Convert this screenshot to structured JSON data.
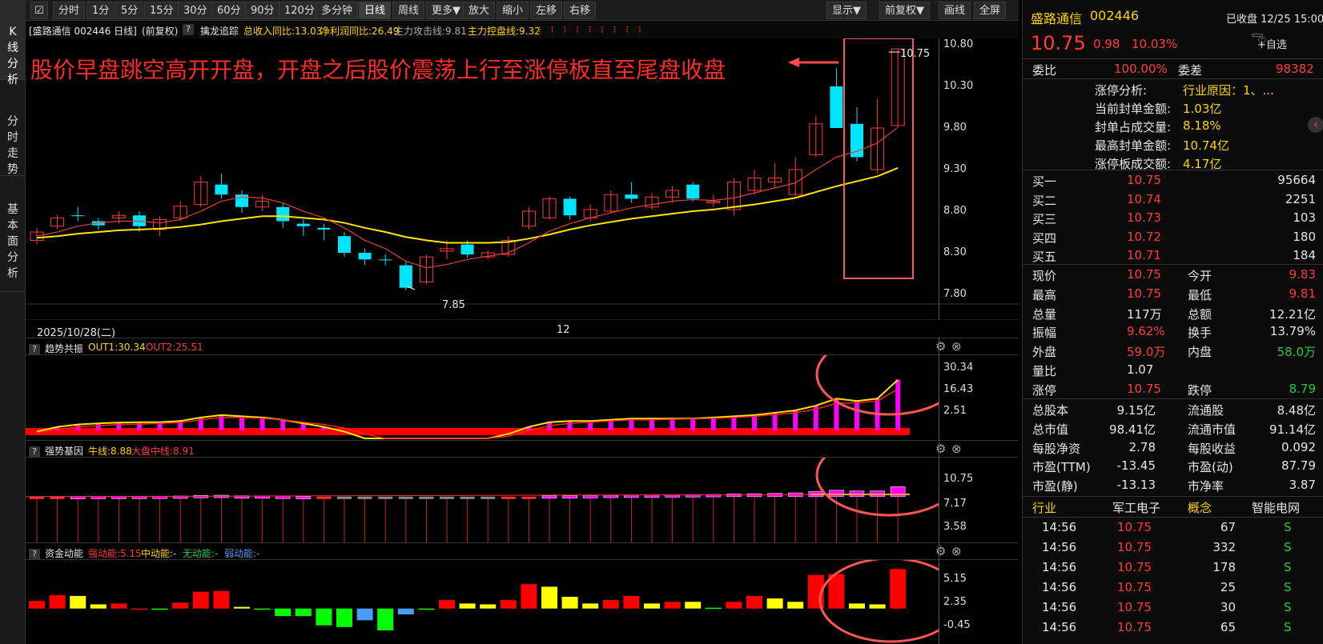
{
  "sidebar": {
    "tabs": [
      {
        "label": "K线分析"
      },
      {
        "label": "分时走势"
      },
      {
        "label": "基本面分析"
      }
    ]
  },
  "toolbar": {
    "left": [
      "分时",
      "1分",
      "5分",
      "15分",
      "30分",
      "60分",
      "90分",
      "120分",
      "多分钟",
      "日线",
      "周线",
      "更多▼",
      "放大",
      "缩小",
      "左移",
      "右移"
    ],
    "right": [
      "显示▼",
      "前复权▼",
      "画线",
      "全屏"
    ],
    "active": "日线"
  },
  "infobar": {
    "title": "[盛路通信 002446 日线]",
    "adj": "(前复权)",
    "qm": "?",
    "ind_name": "擒龙追踪",
    "rev": "总收入同比:13.03",
    "profit": "净利润同比:26.49",
    "attack": "主力攻击线:9.81",
    "control": "主力控盘线:9.32"
  },
  "annotation": {
    "text": "股价早盘跳空高开开盘，开盘之后股价震荡上行至涨停板直至尾盘收盘"
  },
  "main_chart": {
    "y_ticks": [
      "10.80",
      "10.30",
      "9.80",
      "9.30",
      "8.80",
      "8.30",
      "7.80"
    ],
    "date_left": "2025/10/28(二)",
    "date_mid": "12",
    "high_label": "10.75",
    "low_label": "7.85"
  },
  "panels": [
    {
      "name": "趋势共振",
      "v1": "OUT1:30.34",
      "v2": "OUT2:25.51",
      "ticks": [
        "30.34",
        "16.43",
        "2.51"
      ]
    },
    {
      "name": "强势基因",
      "v1": "牛线:8.88",
      "v2": "大盘中线:8.91",
      "ticks": [
        "10.75",
        "7.17",
        "3.58"
      ]
    },
    {
      "name": "资金动能",
      "v1": "强动能:5.15",
      "v2": "中动能:-",
      "v3": "无动能:-",
      "v4": "弱动能:-",
      "ticks": [
        "5.15",
        "2.35",
        "-0.45"
      ]
    }
  ],
  "chart_data": {
    "type": "candlestick",
    "ylim": [
      7.8,
      10.8
    ],
    "candles": [
      [
        8.45,
        8.55,
        8.4,
        8.6
      ],
      [
        8.62,
        8.72,
        8.58,
        8.76
      ],
      [
        8.75,
        8.74,
        8.68,
        8.85
      ],
      [
        8.68,
        8.63,
        8.58,
        8.72
      ],
      [
        8.72,
        8.75,
        8.65,
        8.8
      ],
      [
        8.75,
        8.62,
        8.55,
        8.8
      ],
      [
        8.58,
        8.7,
        8.5,
        8.74
      ],
      [
        8.72,
        8.86,
        8.68,
        8.92
      ],
      [
        8.88,
        9.15,
        8.85,
        9.22
      ],
      [
        9.12,
        9.0,
        8.95,
        9.25
      ],
      [
        9.0,
        8.85,
        8.78,
        9.05
      ],
      [
        8.85,
        8.92,
        8.8,
        9.0
      ],
      [
        8.85,
        8.68,
        8.6,
        8.9
      ],
      [
        8.65,
        8.62,
        8.5,
        8.7
      ],
      [
        8.6,
        8.58,
        8.45,
        8.65
      ],
      [
        8.5,
        8.3,
        8.25,
        8.55
      ],
      [
        8.3,
        8.22,
        8.15,
        8.35
      ],
      [
        8.22,
        8.21,
        8.15,
        8.28
      ],
      [
        8.15,
        7.88,
        7.85,
        8.2
      ],
      [
        7.95,
        8.25,
        7.92,
        8.28
      ],
      [
        8.32,
        8.35,
        8.22,
        8.45
      ],
      [
        8.4,
        8.28,
        8.24,
        8.45
      ],
      [
        8.25,
        8.3,
        8.22,
        8.33
      ],
      [
        8.28,
        8.45,
        8.25,
        8.5
      ],
      [
        8.62,
        8.8,
        8.58,
        8.85
      ],
      [
        8.72,
        8.95,
        8.7,
        8.98
      ],
      [
        8.95,
        8.75,
        8.7,
        8.98
      ],
      [
        8.72,
        8.82,
        8.68,
        8.88
      ],
      [
        8.8,
        9.0,
        8.78,
        9.05
      ],
      [
        9.0,
        8.95,
        8.9,
        9.15
      ],
      [
        8.85,
        8.97,
        8.82,
        9.02
      ],
      [
        8.97,
        9.05,
        8.9,
        9.1
      ],
      [
        9.12,
        8.95,
        8.92,
        9.15
      ],
      [
        8.9,
        8.92,
        8.85,
        9.0
      ],
      [
        8.82,
        9.15,
        8.75,
        9.2
      ],
      [
        9.05,
        9.2,
        9.0,
        9.3
      ],
      [
        9.15,
        9.2,
        9.08,
        9.38
      ],
      [
        9.0,
        9.3,
        8.98,
        9.45
      ],
      [
        9.48,
        9.85,
        9.45,
        9.95
      ],
      [
        10.3,
        9.8,
        9.8,
        10.52
      ],
      [
        9.85,
        9.45,
        9.4,
        10.05
      ],
      [
        9.3,
        9.8,
        9.25,
        10.15
      ],
      [
        9.83,
        10.75,
        9.81,
        10.75
      ]
    ],
    "attack_line": [
      8.5,
      8.55,
      8.62,
      8.66,
      8.68,
      8.68,
      8.66,
      8.7,
      8.8,
      8.92,
      8.97,
      8.96,
      8.9,
      8.8,
      8.72,
      8.6,
      8.45,
      8.35,
      8.2,
      8.12,
      8.16,
      8.22,
      8.26,
      8.3,
      8.42,
      8.56,
      8.65,
      8.72,
      8.78,
      8.84,
      8.88,
      8.92,
      8.94,
      8.93,
      8.96,
      9.02,
      9.08,
      9.14,
      9.3,
      9.45,
      9.52,
      9.62,
      9.81
    ],
    "control_line": [
      8.48,
      8.5,
      8.53,
      8.55,
      8.57,
      8.58,
      8.59,
      8.61,
      8.64,
      8.68,
      8.71,
      8.74,
      8.74,
      8.72,
      8.7,
      8.66,
      8.6,
      8.55,
      8.49,
      8.45,
      8.42,
      8.42,
      8.42,
      8.43,
      8.47,
      8.52,
      8.58,
      8.63,
      8.67,
      8.71,
      8.74,
      8.77,
      8.8,
      8.82,
      8.85,
      8.88,
      8.92,
      8.96,
      9.03,
      9.1,
      9.16,
      9.22,
      9.32
    ]
  },
  "right": {
    "name": "盛路通信",
    "code": "002446",
    "status": "已收盘 12/25 15:00",
    "price": "10.75",
    "chg": "0.98",
    "pct": "10.03%",
    "fav": "+自选",
    "webi_l": "委比",
    "webi_v": "100.00%",
    "wecha_l": "委差",
    "wecha_v": "98382",
    "zt": [
      {
        "l": "涨停分析:",
        "v": "行业原因：1、..."
      },
      {
        "l": "当前封单金额:",
        "v": "1.03亿"
      },
      {
        "l": "封单占成交量:",
        "v": "8.18%"
      },
      {
        "l": "最高封单金额:",
        "v": "10.74亿"
      },
      {
        "l": "涨停板成交额:",
        "v": "4.17亿"
      }
    ],
    "bids": [
      {
        "l": "买一",
        "p": "10.75",
        "v": "95664"
      },
      {
        "l": "买二",
        "p": "10.74",
        "v": "2251"
      },
      {
        "l": "买三",
        "p": "10.73",
        "v": "103"
      },
      {
        "l": "买四",
        "p": "10.72",
        "v": "180"
      },
      {
        "l": "买五",
        "p": "10.71",
        "v": "184"
      }
    ],
    "stats1": [
      {
        "l1": "现价",
        "v1": "10.75",
        "c1": "red",
        "l2": "今开",
        "v2": "9.83",
        "c2": "red"
      },
      {
        "l1": "最高",
        "v1": "10.75",
        "c1": "red",
        "l2": "最低",
        "v2": "9.81",
        "c2": "red"
      },
      {
        "l1": "总量",
        "v1": "117万",
        "c1": "wht",
        "l2": "总额",
        "v2": "12.21亿",
        "c2": "wht"
      },
      {
        "l1": "振幅",
        "v1": "9.62%",
        "c1": "red",
        "l2": "换手",
        "v2": "13.79%",
        "c2": "wht"
      },
      {
        "l1": "外盘",
        "v1": "59.0万",
        "c1": "red",
        "l2": "内盘",
        "v2": "58.0万",
        "c2": "grn"
      },
      {
        "l1": "量比",
        "v1": "1.07",
        "c1": "wht",
        "l2": "",
        "v2": "",
        "c2": "wht"
      },
      {
        "l1": "涨停",
        "v1": "10.75",
        "c1": "red",
        "l2": "跌停",
        "v2": "8.79",
        "c2": "grn"
      }
    ],
    "stats2": [
      {
        "l1": "总股本",
        "v1": "9.15亿",
        "l2": "流通股",
        "v2": "8.48亿"
      },
      {
        "l1": "总市值",
        "v1": "98.41亿",
        "l2": "流通市值",
        "v2": "91.14亿"
      },
      {
        "l1": "每股净资",
        "v1": "2.78",
        "l2": "每股收益",
        "v2": "0.092"
      },
      {
        "l1": "市盈(TTM)",
        "v1": "-13.45",
        "l2": "市盈(动)",
        "v2": "87.79"
      },
      {
        "l1": "市盈(静)",
        "v1": "-13.13",
        "l2": "市净率",
        "v2": "3.87"
      }
    ],
    "industry": {
      "l1": "行业",
      "v1": "军工电子",
      "l2": "概念",
      "v2": "智能电网"
    },
    "ticks": [
      {
        "t": "14:56",
        "p": "10.75",
        "v": "67",
        "s": "S"
      },
      {
        "t": "14:56",
        "p": "10.75",
        "v": "332",
        "s": "S"
      },
      {
        "t": "14:56",
        "p": "10.75",
        "v": "178",
        "s": "S"
      },
      {
        "t": "14:56",
        "p": "10.75",
        "v": "25",
        "s": "S"
      },
      {
        "t": "14:56",
        "p": "10.75",
        "v": "30",
        "s": "S"
      },
      {
        "t": "14:56",
        "p": "10.75",
        "v": "65",
        "s": "S"
      }
    ]
  }
}
